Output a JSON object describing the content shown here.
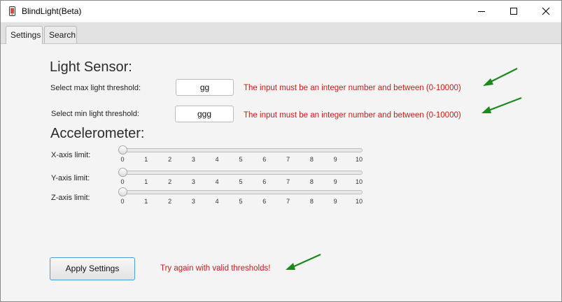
{
  "window": {
    "title": "BlindLight(Beta)",
    "controls": [
      "minimize-icon",
      "maximize-icon",
      "close-icon"
    ]
  },
  "tabs": [
    {
      "label": "Settings",
      "active": true
    },
    {
      "label": "Search",
      "active": false
    }
  ],
  "light_sensor": {
    "title": "Light Sensor:",
    "max": {
      "label": "Select max light threshold:",
      "value": "gg",
      "error": "The input must be an integer number and between (0-10000)"
    },
    "min": {
      "label": "Select min light threshold:",
      "value": "ggg",
      "error": "The input must be an integer number and between (0-10000)"
    }
  },
  "accelerometer": {
    "title": "Accelerometer:",
    "sliders": [
      {
        "label": "X-axis limit:",
        "value": 0,
        "min": 0,
        "max": 10
      },
      {
        "label": "Y-axis limit:",
        "value": 0,
        "min": 0,
        "max": 10
      },
      {
        "label": "Z-axis limit:",
        "value": 0,
        "min": 0,
        "max": 10
      }
    ],
    "tick_labels": [
      "0",
      "1",
      "2",
      "3",
      "4",
      "5",
      "6",
      "7",
      "8",
      "9",
      "10"
    ]
  },
  "apply": {
    "label": "Apply Settings",
    "status": "Try again with valid thresholds!"
  },
  "colors": {
    "error_text": "#c71a1a",
    "annotation_arrow": "#1a8a1a",
    "focus_border": "#4c9ed9"
  }
}
